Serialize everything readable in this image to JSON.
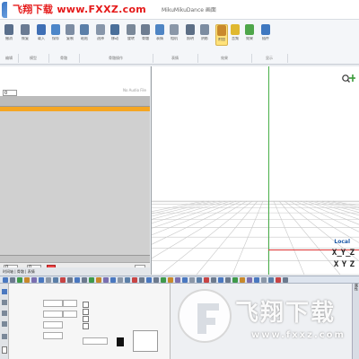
{
  "title_bar": {
    "watermark_top": "飞翔下载 www.FXXZ.com",
    "window_title": "MikuMikuDance 画面"
  },
  "ribbon": {
    "groups": [
      {
        "label": "编辑"
      },
      {
        "label": "模型"
      },
      {
        "label": "骨骼"
      },
      {
        "label": "骨骼操作"
      },
      {
        "label": "表情"
      },
      {
        "label": "效果"
      },
      {
        "label": "显示"
      }
    ],
    "buttons": [
      "撤消",
      "恢复",
      "载入",
      "保存",
      "复制",
      "粘贴",
      "选择",
      "移动",
      "旋转",
      "骨骼",
      "表情",
      "相机",
      "照明",
      "阴影",
      "附加",
      "音频",
      "效果",
      "插件"
    ],
    "active_button": "附加"
  },
  "timeline": {
    "audio_label": "No Audio File",
    "frame_value": "0",
    "controls": [
      "0",
      "0"
    ],
    "bottom_tabs": "时间轴 | 骨骼 | 表情"
  },
  "viewport": {
    "local_label": "Local",
    "gizmo_line1": "X̲Y̲Z",
    "gizmo_line2": "X Y Z"
  },
  "bottom_panel": {
    "side_tab": "属性"
  },
  "watermark": {
    "text": "飞翔下载",
    "url": "www.fxxz.com"
  },
  "colors": {
    "accent": "#f5a623",
    "title_watermark": "#e51a1a",
    "axis_green": "#48b048",
    "axis_red": "#dd3333",
    "local_blue": "#1e5aa8"
  }
}
